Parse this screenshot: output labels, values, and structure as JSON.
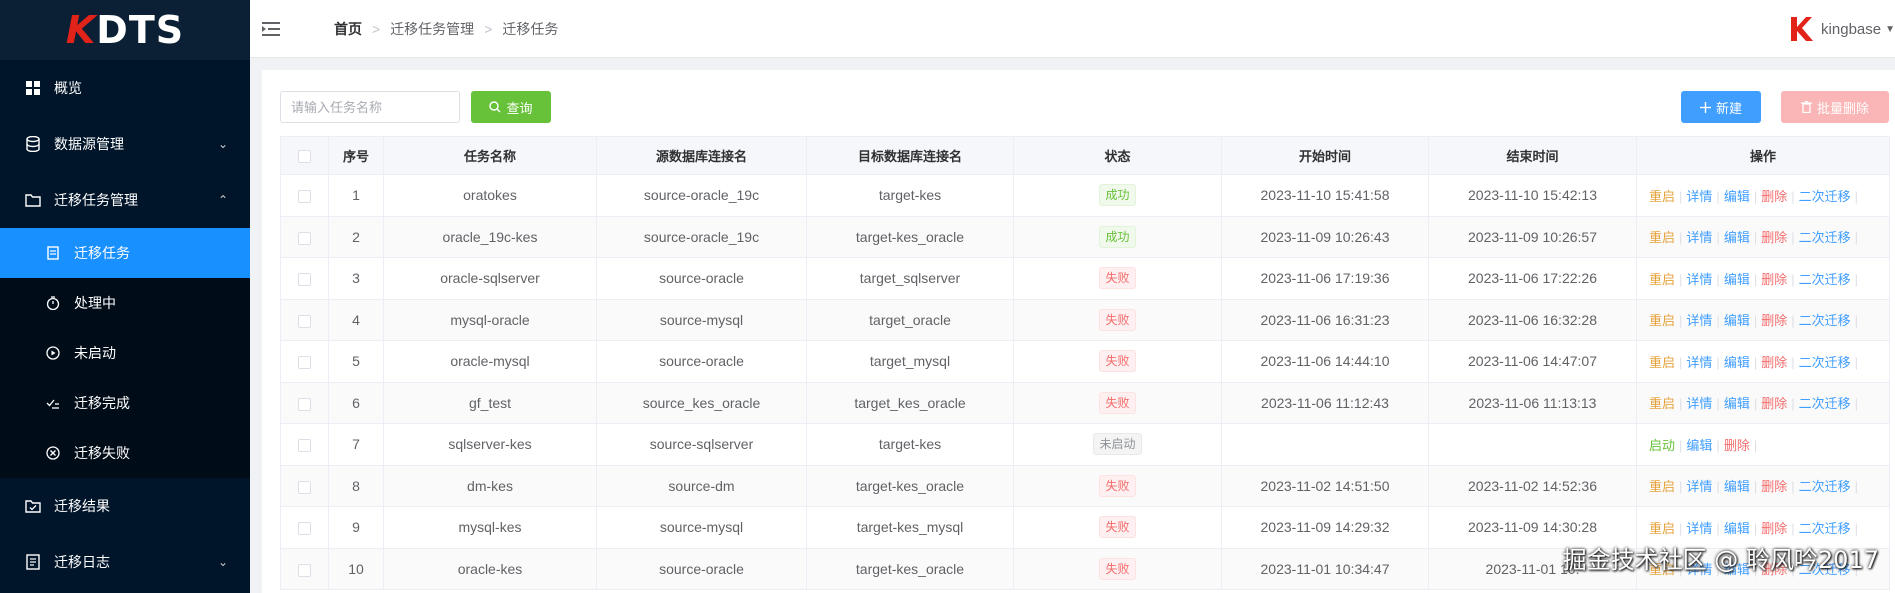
{
  "app": {
    "logo_k": "K",
    "logo_rest": "DTS"
  },
  "sidebar": {
    "items": [
      {
        "label": "概览"
      },
      {
        "label": "数据源管理"
      },
      {
        "label": "迁移任务管理"
      },
      {
        "label": "迁移结果"
      },
      {
        "label": "迁移日志"
      }
    ],
    "submenu": [
      {
        "label": "迁移任务"
      },
      {
        "label": "处理中"
      },
      {
        "label": "未启动"
      },
      {
        "label": "迁移完成"
      },
      {
        "label": "迁移失败"
      }
    ]
  },
  "header": {
    "breadcrumb": [
      "首页",
      "迁移任务管理",
      "迁移任务"
    ],
    "user": "kingbase"
  },
  "toolbar": {
    "search_placeholder": "请输入任务名称",
    "query_label": "查询",
    "new_label": "新建",
    "batch_delete_label": "批量删除"
  },
  "table": {
    "columns": [
      "序号",
      "任务名称",
      "源数据库连接名",
      "目标数据库连接名",
      "状态",
      "开始时间",
      "结束时间",
      "操作"
    ],
    "rows": [
      {
        "no": "1",
        "name": "oratokes",
        "src": "source-oracle_19c",
        "tgt": "target-kes",
        "status": "成功",
        "kind": "success",
        "start": "2023-11-10 15:41:58",
        "end": "2023-11-10 15:42:13"
      },
      {
        "no": "2",
        "name": "oracle_19c-kes",
        "src": "source-oracle_19c",
        "tgt": "target-kes_oracle",
        "status": "成功",
        "kind": "success",
        "start": "2023-11-09 10:26:43",
        "end": "2023-11-09 10:26:57"
      },
      {
        "no": "3",
        "name": "oracle-sqlserver",
        "src": "source-oracle",
        "tgt": "target_sqlserver",
        "status": "失败",
        "kind": "fail",
        "start": "2023-11-06 17:19:36",
        "end": "2023-11-06 17:22:26"
      },
      {
        "no": "4",
        "name": "mysql-oracle",
        "src": "source-mysql",
        "tgt": "target_oracle",
        "status": "失败",
        "kind": "fail",
        "start": "2023-11-06 16:31:23",
        "end": "2023-11-06 16:32:28"
      },
      {
        "no": "5",
        "name": "oracle-mysql",
        "src": "source-oracle",
        "tgt": "target_mysql",
        "status": "失败",
        "kind": "fail",
        "start": "2023-11-06 14:44:10",
        "end": "2023-11-06 14:47:07"
      },
      {
        "no": "6",
        "name": "gf_test",
        "src": "source_kes_oracle",
        "tgt": "target_kes_oracle",
        "status": "失败",
        "kind": "fail",
        "start": "2023-11-06 11:12:43",
        "end": "2023-11-06 11:13:13"
      },
      {
        "no": "7",
        "name": "sqlserver-kes",
        "src": "source-sqlserver",
        "tgt": "target-kes",
        "status": "未启动",
        "kind": "notstarted",
        "start": "",
        "end": ""
      },
      {
        "no": "8",
        "name": "dm-kes",
        "src": "source-dm",
        "tgt": "target-kes_oracle",
        "status": "失败",
        "kind": "fail",
        "start": "2023-11-02 14:51:50",
        "end": "2023-11-02 14:52:36"
      },
      {
        "no": "9",
        "name": "mysql-kes",
        "src": "source-mysql",
        "tgt": "target-kes_mysql",
        "status": "失败",
        "kind": "fail",
        "start": "2023-11-09 14:29:32",
        "end": "2023-11-09 14:30:28"
      },
      {
        "no": "10",
        "name": "oracle-kes",
        "src": "source-oracle",
        "tgt": "target-kes_oracle",
        "status": "失败",
        "kind": "fail",
        "start": "2023-11-01 10:34:47",
        "end": "2023-11-01 10:"
      }
    ],
    "ops_full": [
      {
        "label": "重启",
        "kind": "restart"
      },
      {
        "label": "详情",
        "kind": "detail"
      },
      {
        "label": "编辑",
        "kind": "edit"
      },
      {
        "label": "删除",
        "kind": "delete"
      },
      {
        "label": "二次迁移",
        "kind": "second"
      }
    ],
    "ops_notstarted": [
      {
        "label": "启动",
        "kind": "start"
      },
      {
        "label": "编辑",
        "kind": "edit"
      },
      {
        "label": "删除",
        "kind": "delete"
      }
    ]
  },
  "watermark": "掘金技术社区 @ 聆风吟2017",
  "colors": {
    "sidebar_bg": "#001529",
    "active": "#1890ff",
    "success": "#67c23a",
    "danger": "#f56c6c",
    "primary": "#409eff"
  }
}
